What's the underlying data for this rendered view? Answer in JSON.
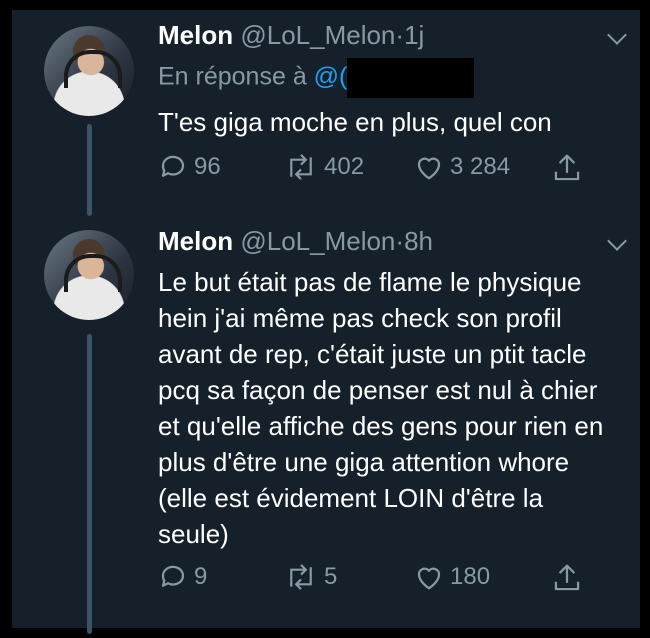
{
  "colors": {
    "background": "#15202b",
    "text": "#ffffff",
    "muted": "#8899a6",
    "accent": "#1da1f2"
  },
  "tweets": [
    {
      "name": "Melon",
      "handle": "@LoL_Melon",
      "time": "1j",
      "reply_prefix": "En réponse à ",
      "reply_mention": "@(",
      "text": "T'es giga moche en plus, quel con",
      "replies": "96",
      "retweets": "402",
      "likes": "3 284"
    },
    {
      "name": "Melon",
      "handle": "@LoL_Melon",
      "time": "8h",
      "text": "Le but était pas de flame le physique hein j'ai même pas check son profil avant de rep, c'était juste un ptit tacle pcq sa façon de penser est nul à chier et qu'elle affiche des gens pour rien en plus d'être une giga attention whore (elle est évidement LOIN d'être la seule)",
      "replies": "9",
      "retweets": "5",
      "likes": "180"
    }
  ],
  "icons": [
    "reply-icon",
    "retweet-icon",
    "like-icon",
    "share-icon",
    "chevron-down-icon"
  ],
  "separator": "·"
}
